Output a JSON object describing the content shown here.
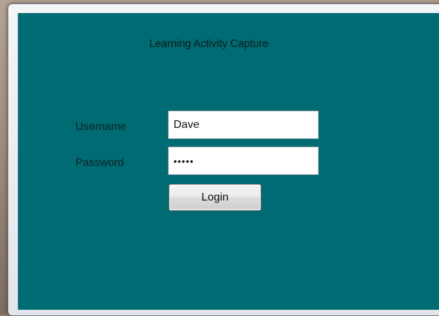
{
  "app": {
    "title": "Learning Activity Capture"
  },
  "form": {
    "username_label": "Username",
    "username_value": "Dave",
    "password_label": "Password",
    "password_value": "•••••",
    "login_label": "Login"
  },
  "colors": {
    "client_background": "#006b72",
    "window_frame": "#e2e5ea",
    "desktop": "#9c8b7a"
  }
}
